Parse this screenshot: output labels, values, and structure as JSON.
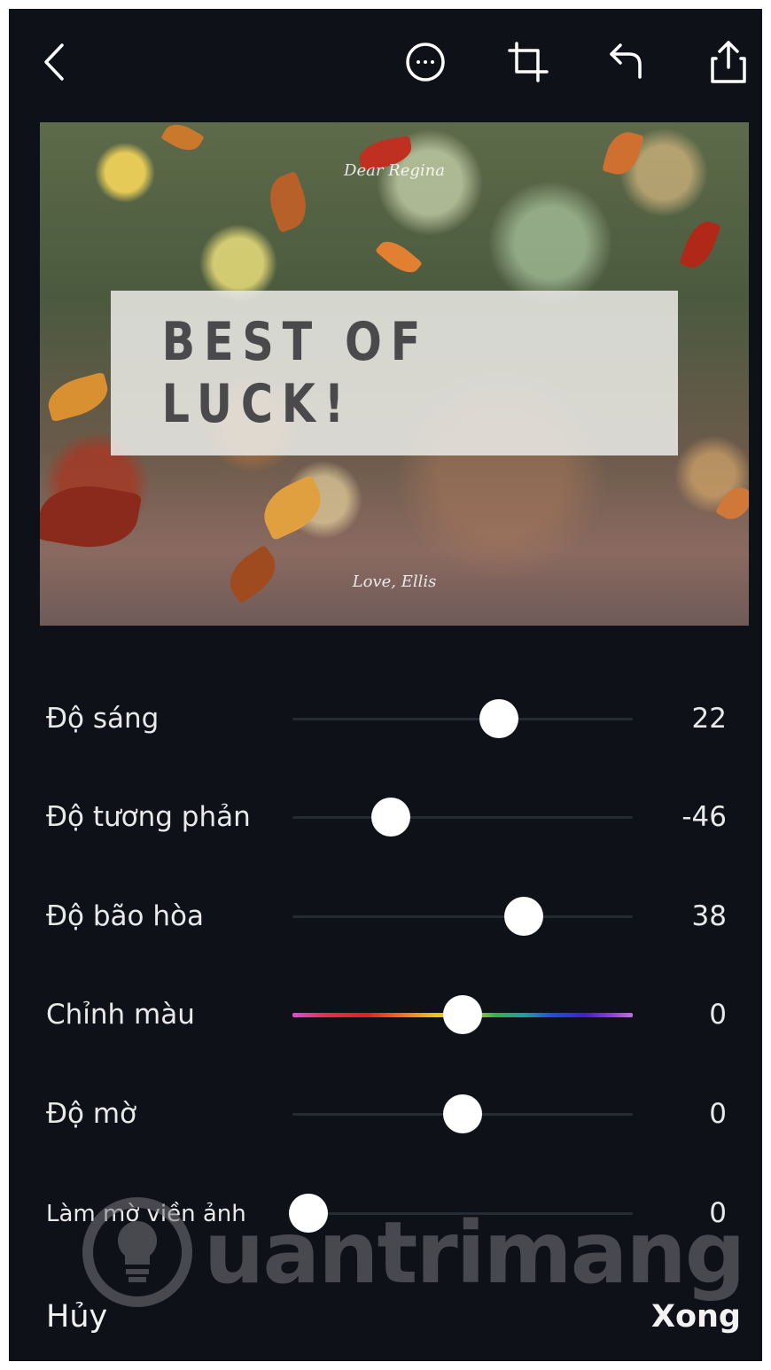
{
  "toolbar": {
    "icons": [
      "back-icon",
      "more-icon",
      "crop-icon",
      "undo-icon",
      "share-icon"
    ]
  },
  "photo": {
    "headline": "BEST OF LUCK!",
    "top_script": "Dear Regina",
    "bottom_script": "Love, Ellis"
  },
  "adjustments": [
    {
      "label": "Độ sáng",
      "value": "22",
      "level": 22
    },
    {
      "label": "Độ tương phản",
      "value": "-46",
      "level": -46
    },
    {
      "label": "Độ bão hòa",
      "value": "38",
      "level": 38
    },
    {
      "label": "Chỉnh màu",
      "value": "0",
      "level": 0
    },
    {
      "label": "Độ mờ",
      "value": "0",
      "level": 0
    },
    {
      "label": "Làm mờ viền ảnh",
      "value": "0",
      "level": 0
    }
  ],
  "actions": {
    "cancel": "Hủy",
    "done": "Xong"
  },
  "watermark": {
    "text": "uantrimang",
    "color": "#7a7a80"
  },
  "colors": {
    "background": "#0e1117",
    "track": "#252a33",
    "text": "#e9e9ea"
  }
}
